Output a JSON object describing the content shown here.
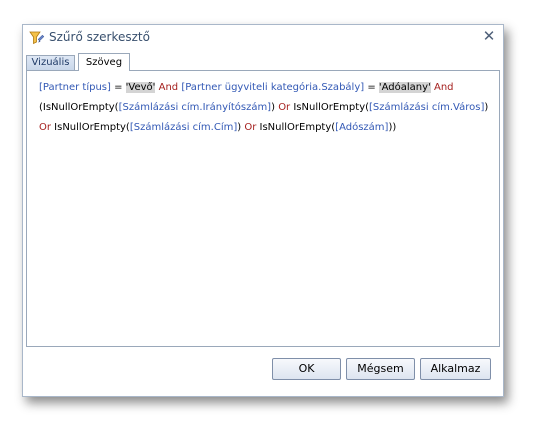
{
  "window": {
    "title": "Szűrő szerkesztő",
    "close_glyph": "✕",
    "title_icon": "filter-edit-icon"
  },
  "tabs": [
    {
      "label": "Vizuális",
      "active": false
    },
    {
      "label": "Szöveg",
      "active": true
    }
  ],
  "expression": {
    "lines": [
      [
        {
          "t": "[Partner típus]",
          "k": "fld"
        },
        {
          "t": " = ",
          "k": "plain"
        },
        {
          "t": "'Vevő'",
          "k": "str"
        },
        {
          "t": " And ",
          "k": "kw"
        },
        {
          "t": "[Partner ügyviteli kategória.Szabály]",
          "k": "fld"
        },
        {
          "t": " = ",
          "k": "plain"
        },
        {
          "t": "'Adóalany'",
          "k": "str"
        },
        {
          "t": " And",
          "k": "kw"
        }
      ],
      [
        {
          "t": "(IsNullOrEmpty(",
          "k": "plain"
        },
        {
          "t": "[Számlázási cím.Irányítószám]",
          "k": "fld"
        },
        {
          "t": ") ",
          "k": "plain"
        },
        {
          "t": "Or",
          "k": "kw"
        },
        {
          "t": " IsNullOrEmpty(",
          "k": "plain"
        },
        {
          "t": "[Számlázási cím.Város]",
          "k": "fld"
        },
        {
          "t": ")",
          "k": "plain"
        }
      ],
      [
        {
          "t": "Or",
          "k": "kw"
        },
        {
          "t": " IsNullOrEmpty(",
          "k": "plain"
        },
        {
          "t": "[Számlázási cím.Cím]",
          "k": "fld"
        },
        {
          "t": ") ",
          "k": "plain"
        },
        {
          "t": "Or",
          "k": "kw"
        },
        {
          "t": " IsNullOrEmpty(",
          "k": "plain"
        },
        {
          "t": "[Adószám]",
          "k": "fld"
        },
        {
          "t": "))",
          "k": "plain"
        }
      ]
    ]
  },
  "buttons": {
    "ok": "OK",
    "cancel": "Mégsem",
    "apply": "Alkalmaz"
  },
  "colors": {
    "field": "#3359b5",
    "keyword": "#a5211f",
    "string_bg": "#d4d4d4"
  }
}
